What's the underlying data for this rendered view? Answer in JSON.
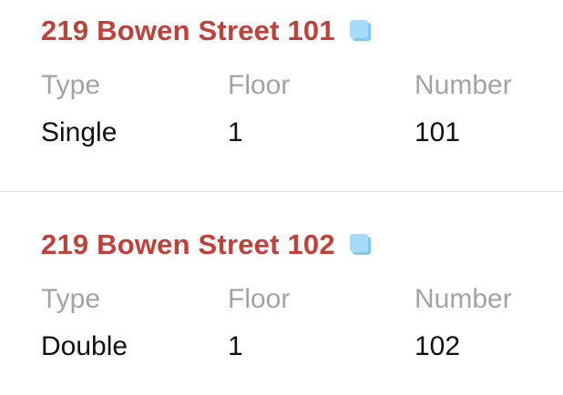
{
  "items": [
    {
      "title": "219 Bowen Street 101",
      "copy_icon": "copy-icon",
      "type_label": "Type",
      "floor_label": "Floor",
      "number_label": "Number",
      "type_value": "Single",
      "floor_value": "1",
      "number_value": "101"
    },
    {
      "title": "219 Bowen Street 102",
      "copy_icon": "copy-icon",
      "type_label": "Type",
      "floor_label": "Floor",
      "number_label": "Number",
      "type_value": "Double",
      "floor_value": "1",
      "number_value": "102"
    }
  ],
  "colors": {
    "title": "#c0413a",
    "label": "#a3a3a3",
    "value": "#111111",
    "icon": "#a6dcfa",
    "divider": "#e6e6e6"
  }
}
